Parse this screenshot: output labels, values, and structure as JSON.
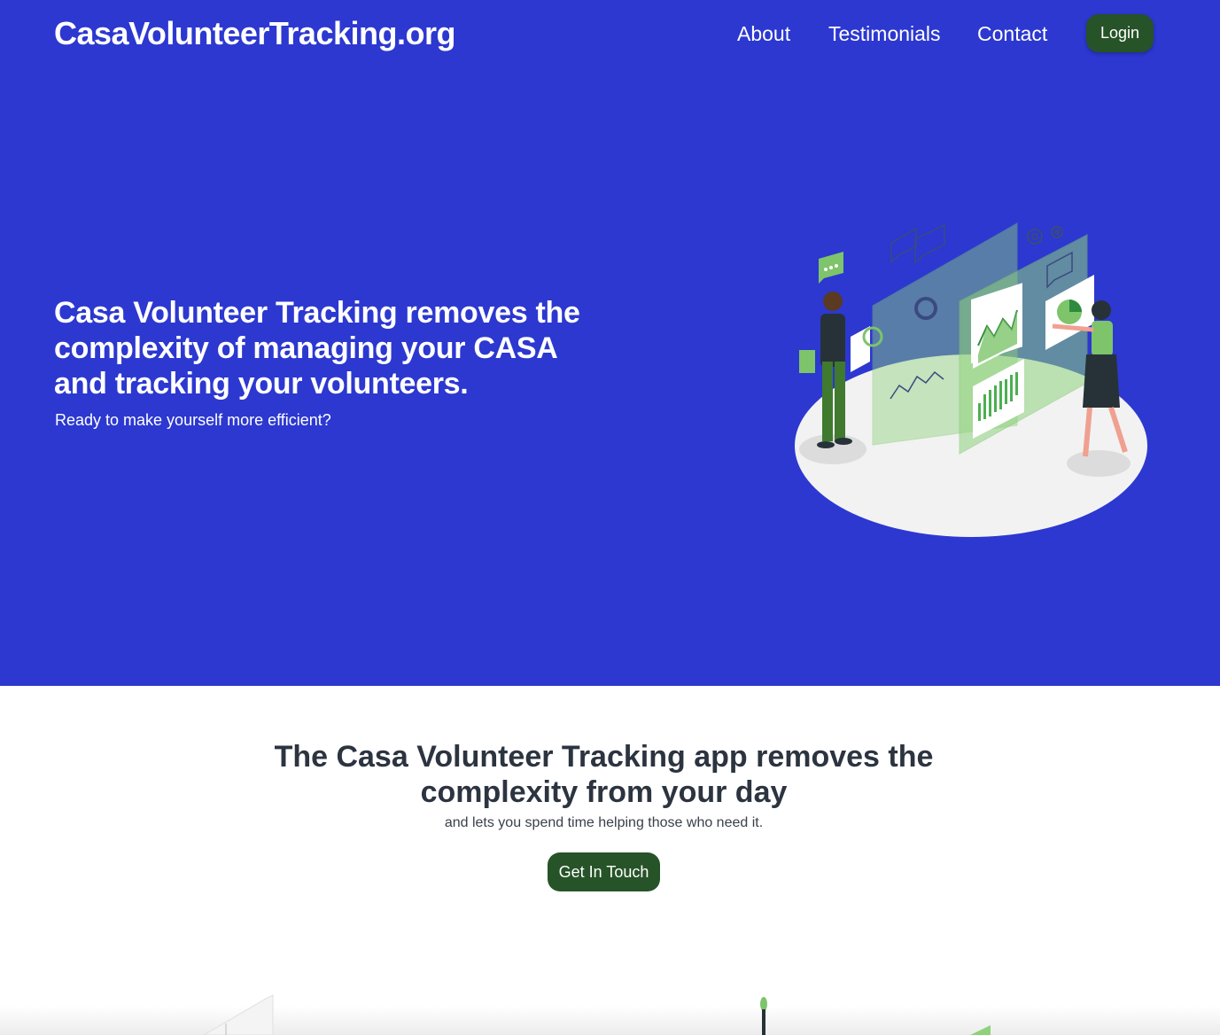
{
  "header": {
    "brand": "CasaVolunteerTracking.org",
    "nav": [
      {
        "label": "About"
      },
      {
        "label": "Testimonials"
      },
      {
        "label": "Contact"
      }
    ],
    "login_label": "Login"
  },
  "hero": {
    "title": "Casa Volunteer Tracking removes the complexity of managing your CASA and tracking your volunteers.",
    "subtitle": "Ready to make yourself more efficient?"
  },
  "section2": {
    "title": "The Casa Volunteer Tracking app removes the complexity from your day",
    "subtitle": "and lets you spend time helping those who need it.",
    "cta_label": "Get In Touch"
  },
  "colors": {
    "hero_bg": "#2c38d0",
    "button_green": "#275328",
    "illustration_green": "#7dc46b",
    "text_dark": "#2c3440"
  },
  "icons": [
    "chat-bubble-icon",
    "gear-icon",
    "donut-chart-icon",
    "bar-chart-icon"
  ]
}
